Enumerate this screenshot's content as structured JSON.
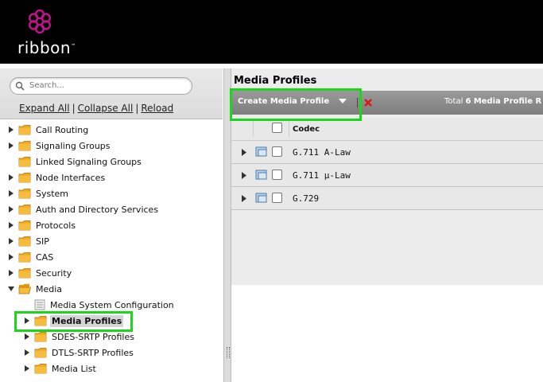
{
  "brand": {
    "name": "ribbon",
    "logo_icon": "ribbon-logo-icon",
    "accent_color": "#c0148c"
  },
  "nav": {
    "search_placeholder": "Search...",
    "expand_all": "Expand All",
    "collapse_all": "Collapse All",
    "reload": "Reload",
    "separator": "|",
    "tree": [
      {
        "label": "Call Routing"
      },
      {
        "label": "Signaling Groups"
      },
      {
        "label": "Linked Signaling Groups"
      },
      {
        "label": "Node Interfaces"
      },
      {
        "label": "System"
      },
      {
        "label": "Auth and Directory Services"
      },
      {
        "label": "Protocols"
      },
      {
        "label": "SIP"
      },
      {
        "label": "CAS"
      },
      {
        "label": "Security"
      },
      {
        "label": "Media",
        "expanded": true
      },
      {
        "label": "Media System Configuration"
      },
      {
        "label": "Media Profiles",
        "selected": true
      },
      {
        "label": "SDES-SRTP Profiles"
      },
      {
        "label": "DTLS-SRTP Profiles"
      },
      {
        "label": "Media List"
      }
    ]
  },
  "main": {
    "title": "Media Profiles",
    "toolbar": {
      "create_label": "Create Media Profile",
      "total_prefix": "Total",
      "total_count": "6",
      "total_suffix": "Media Profile R"
    },
    "table": {
      "column_codec": "Codec",
      "rows": [
        {
          "codec": "G.711 A-Law"
        },
        {
          "codec": "G.711 µ-Law"
        },
        {
          "codec": "G.729"
        }
      ]
    }
  },
  "highlight_color": "#1bd61b"
}
